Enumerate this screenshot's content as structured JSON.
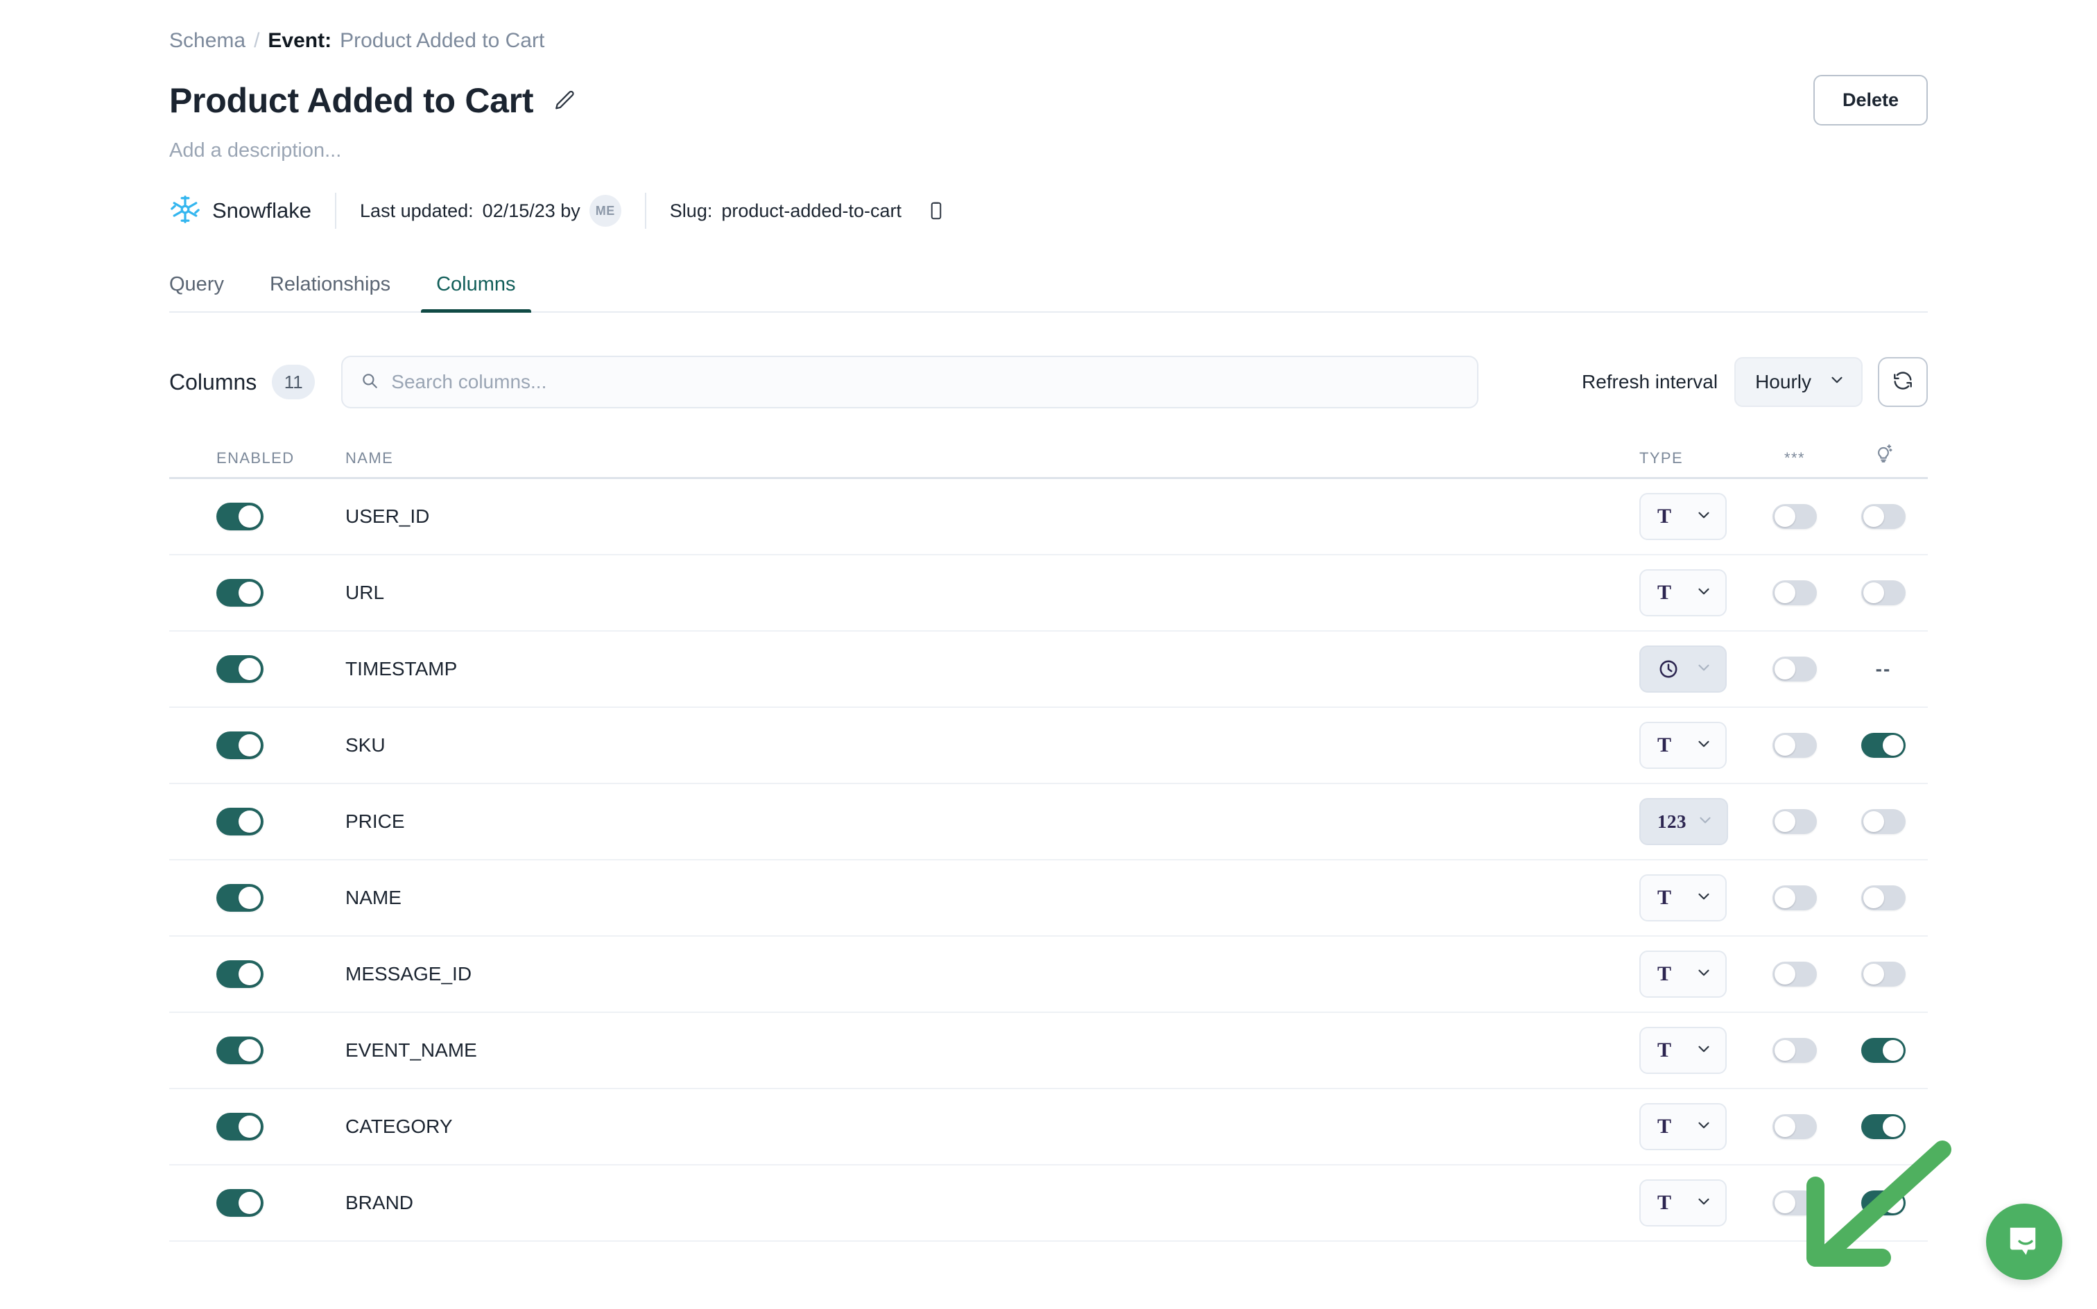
{
  "breadcrumb": {
    "root": "Schema",
    "separator": "/",
    "label": "Event:",
    "current": "Product Added to Cart"
  },
  "header": {
    "title": "Product Added to Cart",
    "edit_icon": "pencil-icon",
    "delete_label": "Delete",
    "description_placeholder": "Add a description..."
  },
  "meta": {
    "source_icon": "snowflake-icon",
    "source_name": "Snowflake",
    "last_updated_key": "Last updated:",
    "last_updated_value": "02/15/23 by",
    "author_initials": "ME",
    "slug_key": "Slug:",
    "slug_value": "product-added-to-cart",
    "copy_icon": "clipboard-icon"
  },
  "tabs": [
    {
      "label": "Query",
      "active": false
    },
    {
      "label": "Relationships",
      "active": false
    },
    {
      "label": "Columns",
      "active": true
    }
  ],
  "toolbar": {
    "columns_label": "Columns",
    "columns_count": "11",
    "search_placeholder": "Search columns...",
    "search_value": "",
    "search_icon": "search-icon",
    "refresh_interval_label": "Refresh interval",
    "refresh_interval_value": "Hourly",
    "refresh_icon": "refresh-icon"
  },
  "table": {
    "headers": {
      "enabled": "ENABLED",
      "name": "NAME",
      "type": "TYPE",
      "pii": "***",
      "ai": "lightbulb-sparkle-icon"
    },
    "rows": [
      {
        "name": "USER_ID",
        "enabled": true,
        "type_glyph": "T",
        "type_kind": "text",
        "type_locked": false,
        "pii": false,
        "ai": false,
        "ai_available": true
      },
      {
        "name": "URL",
        "enabled": true,
        "type_glyph": "T",
        "type_kind": "text",
        "type_locked": false,
        "pii": false,
        "ai": false,
        "ai_available": true
      },
      {
        "name": "TIMESTAMP",
        "enabled": true,
        "type_glyph": "",
        "type_kind": "timestamp",
        "type_locked": true,
        "pii": false,
        "ai": null,
        "ai_available": false,
        "ai_placeholder": "--"
      },
      {
        "name": "SKU",
        "enabled": true,
        "type_glyph": "T",
        "type_kind": "text",
        "type_locked": false,
        "pii": false,
        "ai": true,
        "ai_available": true
      },
      {
        "name": "PRICE",
        "enabled": true,
        "type_glyph": "123",
        "type_kind": "number",
        "type_locked": true,
        "pii": false,
        "ai": false,
        "ai_available": true
      },
      {
        "name": "NAME",
        "enabled": true,
        "type_glyph": "T",
        "type_kind": "text",
        "type_locked": false,
        "pii": false,
        "ai": false,
        "ai_available": true
      },
      {
        "name": "MESSAGE_ID",
        "enabled": true,
        "type_glyph": "T",
        "type_kind": "text",
        "type_locked": false,
        "pii": false,
        "ai": false,
        "ai_available": true
      },
      {
        "name": "EVENT_NAME",
        "enabled": true,
        "type_glyph": "T",
        "type_kind": "text",
        "type_locked": false,
        "pii": false,
        "ai": true,
        "ai_available": true
      },
      {
        "name": "CATEGORY",
        "enabled": true,
        "type_glyph": "T",
        "type_kind": "text",
        "type_locked": false,
        "pii": false,
        "ai": true,
        "ai_available": true
      },
      {
        "name": "BRAND",
        "enabled": true,
        "type_glyph": "T",
        "type_kind": "text",
        "type_locked": false,
        "pii": false,
        "ai": true,
        "ai_available": true
      }
    ]
  },
  "annotations": {
    "arrow_color": "#4fb05f",
    "arrow_target": "brand-ai-toggle"
  },
  "widgets": {
    "chat_icon": "intercom-chat-icon",
    "chat_color": "#4cb163"
  },
  "colors": {
    "accent_teal": "#22645f",
    "tab_active": "#104a45",
    "text_primary": "#1b2430",
    "text_muted": "#7d8a9c",
    "toggle_off": "#d7dce4"
  }
}
